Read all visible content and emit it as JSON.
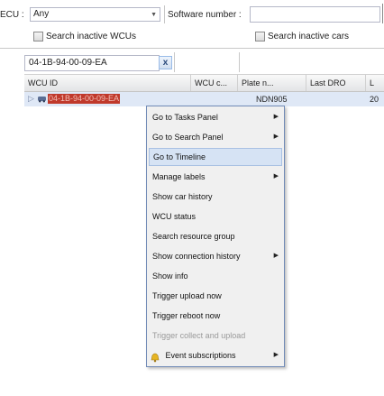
{
  "filters": {
    "ecu_label": "ECU :",
    "ecu_value": "Any",
    "software_label": "Software number :",
    "software_value": "",
    "search_inactive_wcus": "Search inactive WCUs",
    "search_inactive_cars": "Search inactive cars"
  },
  "grid": {
    "filter_value": "04-1B-94-00-09-EA",
    "clear_label": "x",
    "columns": [
      "WCU ID",
      "WCU c...",
      "Plate n...",
      "Last DRO",
      "L"
    ],
    "row": {
      "wcu_id": "04-1B-94-00-09-EA",
      "plate": "NDN905",
      "last": "20"
    }
  },
  "context_menu": {
    "items": [
      {
        "label": "Go to Tasks Panel",
        "submenu": true
      },
      {
        "label": "Go to Search Panel",
        "submenu": true
      },
      {
        "label": "Go to Timeline",
        "submenu": false
      },
      {
        "label": "Manage labels",
        "submenu": true
      },
      {
        "label": "Show car history",
        "submenu": false
      },
      {
        "label": "WCU status",
        "submenu": false
      },
      {
        "label": "Search resource group",
        "submenu": false
      },
      {
        "label": "Show connection history",
        "submenu": true
      },
      {
        "label": "Show info",
        "submenu": false
      },
      {
        "label": "Trigger upload now",
        "submenu": false
      },
      {
        "label": "Trigger reboot now",
        "submenu": false
      },
      {
        "label": "Trigger collect and upload",
        "submenu": false
      },
      {
        "label": "Event subscriptions",
        "submenu": true
      }
    ],
    "active_index": 2,
    "disabled_index": 11
  },
  "icons": {
    "row_expander": "expand-arrow-icon",
    "row_type": "car-icon",
    "event_subscriptions": "bell-icon"
  },
  "colors": {
    "selection": "#dfe8f6",
    "menu_border": "#718bb7",
    "highlight_text_bg": "#c0392b"
  }
}
